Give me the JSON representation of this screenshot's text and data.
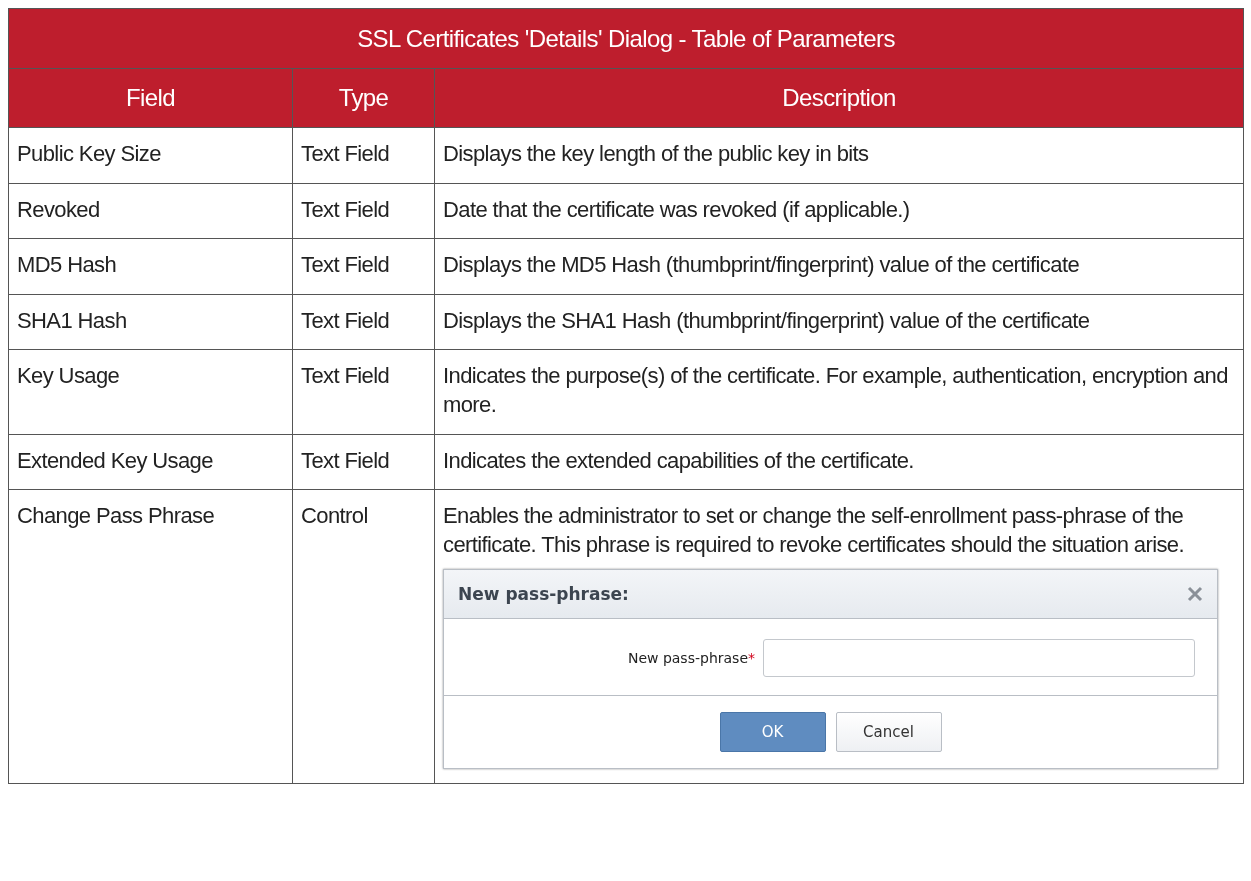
{
  "table": {
    "title": "SSL Certificates 'Details' Dialog - Table of Parameters",
    "columns": [
      "Field",
      "Type",
      "Description"
    ],
    "rows": [
      {
        "field": "Public Key Size",
        "type": "Text Field",
        "description": "Displays the key length of the public key in bits"
      },
      {
        "field": "Revoked",
        "type": "Text Field",
        "description": "Date that the certificate was revoked (if applicable.)"
      },
      {
        "field": "MD5 Hash",
        "type": "Text Field",
        "description": "Displays the MD5 Hash (thumbprint/fingerprint) value of the certificate"
      },
      {
        "field": "SHA1 Hash",
        "type": "Text Field",
        "description": "Displays the SHA1 Hash (thumbprint/fingerprint) value of the certificate"
      },
      {
        "field": "Key Usage",
        "type": "Text Field",
        "description": "Indicates the purpose(s) of the certificate. For example, authentication, encryption and more."
      },
      {
        "field": "Extended Key Usage",
        "type": "Text Field",
        "description": "Indicates the extended capabilities of the certificate."
      },
      {
        "field": "Change Pass Phrase",
        "type": "Control",
        "description": "Enables the administrator to set or change the self-enrollment pass-phrase of the certificate. This phrase is required to revoke certificates should the situation arise.",
        "dialog": {
          "title": "New pass-phrase:",
          "field_label": "New pass-phrase",
          "required_mark": "*",
          "buttons": [
            {
              "label": "OK",
              "kind": "primary"
            },
            {
              "label": "Cancel",
              "kind": "secondary"
            }
          ]
        }
      }
    ]
  }
}
